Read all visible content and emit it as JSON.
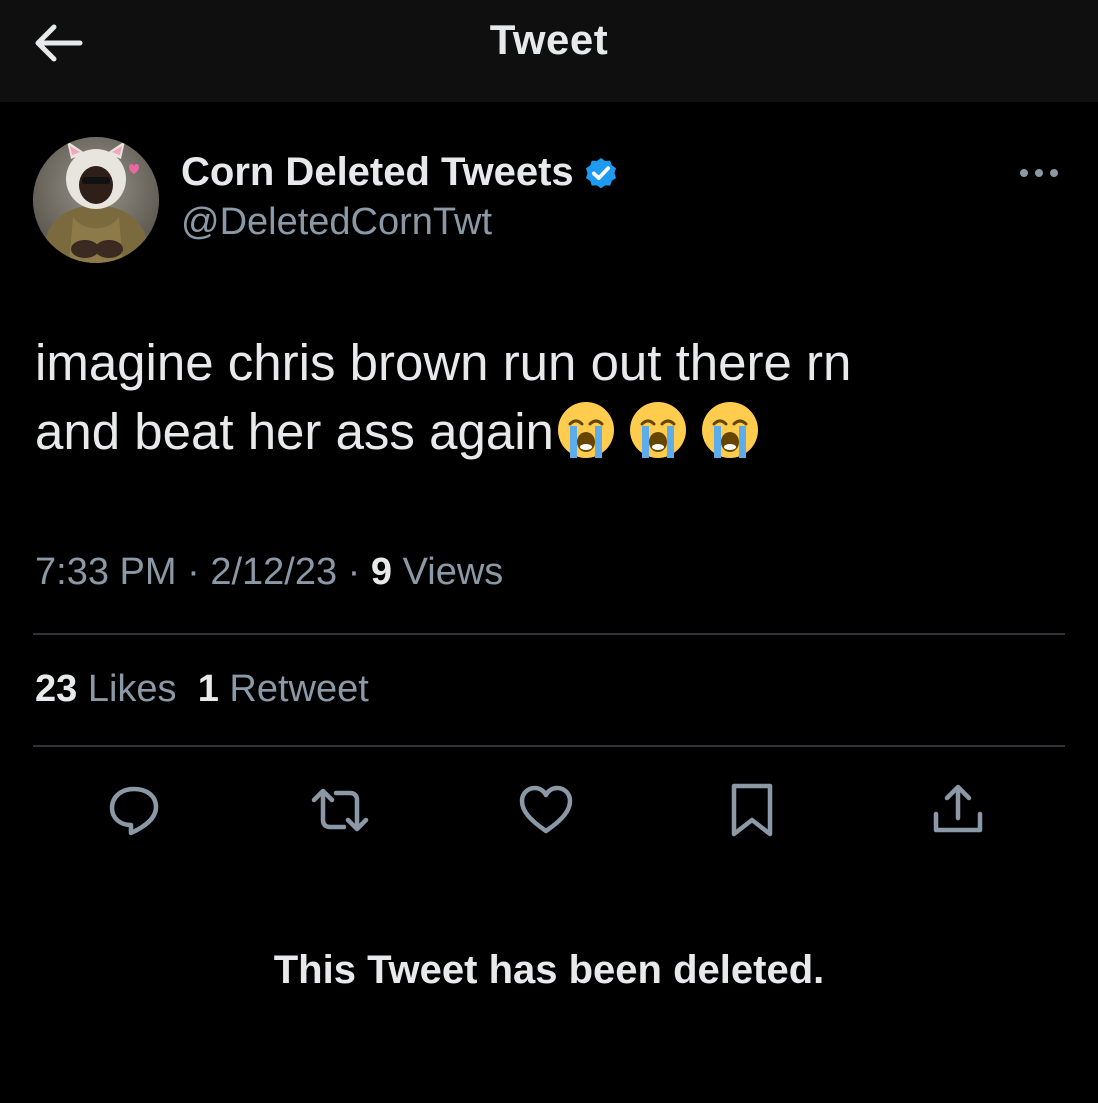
{
  "header": {
    "title": "Tweet",
    "back_icon": "arrow-left-icon"
  },
  "author": {
    "display_name": "Corn Deleted Tweets",
    "handle": "@DeletedCornTwt",
    "verified": true,
    "verified_color": "#1d9bf0",
    "avatar_icon": "profile-avatar"
  },
  "tweet": {
    "text_line_1": "imagine chris brown run out there rn",
    "text_line_2": "and beat her ass again",
    "emojis": [
      "😭",
      "😭",
      "😭"
    ],
    "time": "7:33 PM",
    "date": "2/12/23",
    "separator": "·",
    "views_count": "9",
    "views_label": "Views"
  },
  "stats": {
    "likes_count": "23",
    "likes_label": "Likes",
    "retweets_count": "1",
    "retweets_label": "Retweet"
  },
  "actions": [
    {
      "name": "reply",
      "icon": "reply-icon"
    },
    {
      "name": "retweet",
      "icon": "retweet-icon"
    },
    {
      "name": "like",
      "icon": "heart-icon"
    },
    {
      "name": "bookmark",
      "icon": "bookmark-icon"
    },
    {
      "name": "share",
      "icon": "share-icon"
    }
  ],
  "footer": {
    "deleted_message": "This Tweet has been deleted."
  },
  "colors": {
    "background": "#000000",
    "header_background": "#0f0f0f",
    "primary_text": "#e7e9ea",
    "secondary_text": "#8b98a5",
    "divider": "#2f3336"
  }
}
